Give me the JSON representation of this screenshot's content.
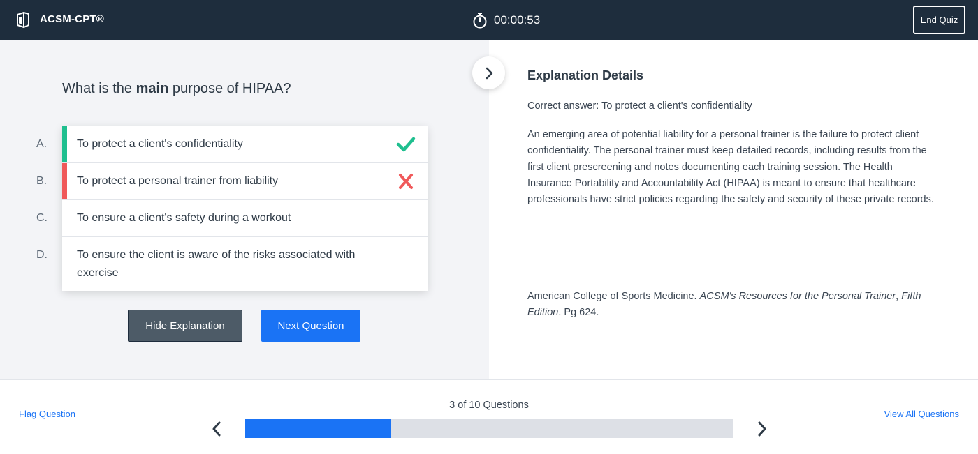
{
  "header": {
    "app_title": "ACSM-CPT®",
    "timer": "00:00:53",
    "end_quiz_label": "End Quiz",
    "logo_icon": "book-logo-icon",
    "timer_icon": "stopwatch-icon"
  },
  "question": {
    "text_before": "What is the ",
    "text_bold": "main",
    "text_after": " purpose of HIPAA?"
  },
  "answers": [
    {
      "letter": "A.",
      "text": "To protect a client's confidentiality",
      "status": "correct"
    },
    {
      "letter": "B.",
      "text": "To protect a personal trainer from liability",
      "status": "incorrect"
    },
    {
      "letter": "C.",
      "text": "To ensure a client's safety during a workout",
      "status": "none"
    },
    {
      "letter": "D.",
      "text": "To ensure the client is aware of the risks associated with exercise",
      "status": "none"
    }
  ],
  "buttons": {
    "hide_explanation": "Hide Explanation",
    "next_question": "Next Question"
  },
  "explanation": {
    "title": "Explanation Details",
    "correct_answer": "Correct answer: To protect a client's confidentiality",
    "body": "An emerging area of potential liability for a personal trainer is the failure to protect client confidentiality. The personal trainer must keep detailed records, including results from the first client prescreening and notes documenting each training session. The Health Insurance Portability and Accountability Act (HIPAA) is meant to ensure that healthcare professionals have strict policies regarding the safety and security of these private records.",
    "reference_prefix": "American College of Sports Medicine. ",
    "reference_title": "ACSM's Resources for the Personal Trainer",
    "reference_sep": ", ",
    "reference_edition": "Fifth Edition",
    "reference_suffix": ". Pg 624."
  },
  "footer": {
    "flag_question": "Flag Question",
    "progress_text": "3 of 10 Questions",
    "progress_fraction": 0.3,
    "view_all": "View All Questions"
  },
  "colors": {
    "header_bg": "#1e2d3d",
    "accent_blue": "#1a73f5",
    "correct_green": "#1fbf8f",
    "incorrect_red": "#f0595a"
  }
}
